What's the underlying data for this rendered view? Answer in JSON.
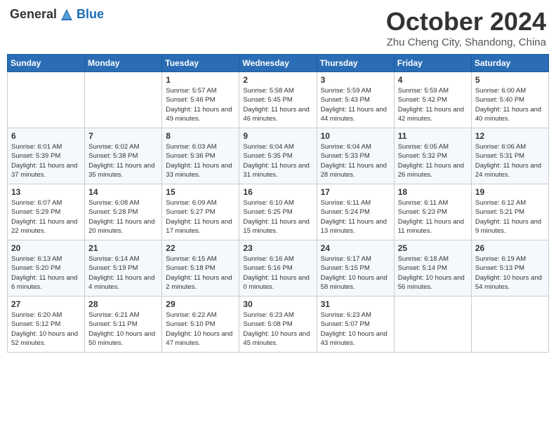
{
  "header": {
    "logo_general": "General",
    "logo_blue": "Blue",
    "month": "October 2024",
    "location": "Zhu Cheng City, Shandong, China"
  },
  "weekdays": [
    "Sunday",
    "Monday",
    "Tuesday",
    "Wednesday",
    "Thursday",
    "Friday",
    "Saturday"
  ],
  "weeks": [
    [
      {
        "day": "",
        "info": ""
      },
      {
        "day": "",
        "info": ""
      },
      {
        "day": "1",
        "info": "Sunrise: 5:57 AM\nSunset: 5:46 PM\nDaylight: 11 hours and 49 minutes."
      },
      {
        "day": "2",
        "info": "Sunrise: 5:58 AM\nSunset: 5:45 PM\nDaylight: 11 hours and 46 minutes."
      },
      {
        "day": "3",
        "info": "Sunrise: 5:59 AM\nSunset: 5:43 PM\nDaylight: 11 hours and 44 minutes."
      },
      {
        "day": "4",
        "info": "Sunrise: 5:59 AM\nSunset: 5:42 PM\nDaylight: 11 hours and 42 minutes."
      },
      {
        "day": "5",
        "info": "Sunrise: 6:00 AM\nSunset: 5:40 PM\nDaylight: 11 hours and 40 minutes."
      }
    ],
    [
      {
        "day": "6",
        "info": "Sunrise: 6:01 AM\nSunset: 5:39 PM\nDaylight: 11 hours and 37 minutes."
      },
      {
        "day": "7",
        "info": "Sunrise: 6:02 AM\nSunset: 5:38 PM\nDaylight: 11 hours and 35 minutes."
      },
      {
        "day": "8",
        "info": "Sunrise: 6:03 AM\nSunset: 5:36 PM\nDaylight: 11 hours and 33 minutes."
      },
      {
        "day": "9",
        "info": "Sunrise: 6:04 AM\nSunset: 5:35 PM\nDaylight: 11 hours and 31 minutes."
      },
      {
        "day": "10",
        "info": "Sunrise: 6:04 AM\nSunset: 5:33 PM\nDaylight: 11 hours and 28 minutes."
      },
      {
        "day": "11",
        "info": "Sunrise: 6:05 AM\nSunset: 5:32 PM\nDaylight: 11 hours and 26 minutes."
      },
      {
        "day": "12",
        "info": "Sunrise: 6:06 AM\nSunset: 5:31 PM\nDaylight: 11 hours and 24 minutes."
      }
    ],
    [
      {
        "day": "13",
        "info": "Sunrise: 6:07 AM\nSunset: 5:29 PM\nDaylight: 11 hours and 22 minutes."
      },
      {
        "day": "14",
        "info": "Sunrise: 6:08 AM\nSunset: 5:28 PM\nDaylight: 11 hours and 20 minutes."
      },
      {
        "day": "15",
        "info": "Sunrise: 6:09 AM\nSunset: 5:27 PM\nDaylight: 11 hours and 17 minutes."
      },
      {
        "day": "16",
        "info": "Sunrise: 6:10 AM\nSunset: 5:25 PM\nDaylight: 11 hours and 15 minutes."
      },
      {
        "day": "17",
        "info": "Sunrise: 6:11 AM\nSunset: 5:24 PM\nDaylight: 11 hours and 13 minutes."
      },
      {
        "day": "18",
        "info": "Sunrise: 6:11 AM\nSunset: 5:23 PM\nDaylight: 11 hours and 11 minutes."
      },
      {
        "day": "19",
        "info": "Sunrise: 6:12 AM\nSunset: 5:21 PM\nDaylight: 11 hours and 9 minutes."
      }
    ],
    [
      {
        "day": "20",
        "info": "Sunrise: 6:13 AM\nSunset: 5:20 PM\nDaylight: 11 hours and 6 minutes."
      },
      {
        "day": "21",
        "info": "Sunrise: 6:14 AM\nSunset: 5:19 PM\nDaylight: 11 hours and 4 minutes."
      },
      {
        "day": "22",
        "info": "Sunrise: 6:15 AM\nSunset: 5:18 PM\nDaylight: 11 hours and 2 minutes."
      },
      {
        "day": "23",
        "info": "Sunrise: 6:16 AM\nSunset: 5:16 PM\nDaylight: 11 hours and 0 minutes."
      },
      {
        "day": "24",
        "info": "Sunrise: 6:17 AM\nSunset: 5:15 PM\nDaylight: 10 hours and 58 minutes."
      },
      {
        "day": "25",
        "info": "Sunrise: 6:18 AM\nSunset: 5:14 PM\nDaylight: 10 hours and 56 minutes."
      },
      {
        "day": "26",
        "info": "Sunrise: 6:19 AM\nSunset: 5:13 PM\nDaylight: 10 hours and 54 minutes."
      }
    ],
    [
      {
        "day": "27",
        "info": "Sunrise: 6:20 AM\nSunset: 5:12 PM\nDaylight: 10 hours and 52 minutes."
      },
      {
        "day": "28",
        "info": "Sunrise: 6:21 AM\nSunset: 5:11 PM\nDaylight: 10 hours and 50 minutes."
      },
      {
        "day": "29",
        "info": "Sunrise: 6:22 AM\nSunset: 5:10 PM\nDaylight: 10 hours and 47 minutes."
      },
      {
        "day": "30",
        "info": "Sunrise: 6:23 AM\nSunset: 5:08 PM\nDaylight: 10 hours and 45 minutes."
      },
      {
        "day": "31",
        "info": "Sunrise: 6:23 AM\nSunset: 5:07 PM\nDaylight: 10 hours and 43 minutes."
      },
      {
        "day": "",
        "info": ""
      },
      {
        "day": "",
        "info": ""
      }
    ]
  ]
}
